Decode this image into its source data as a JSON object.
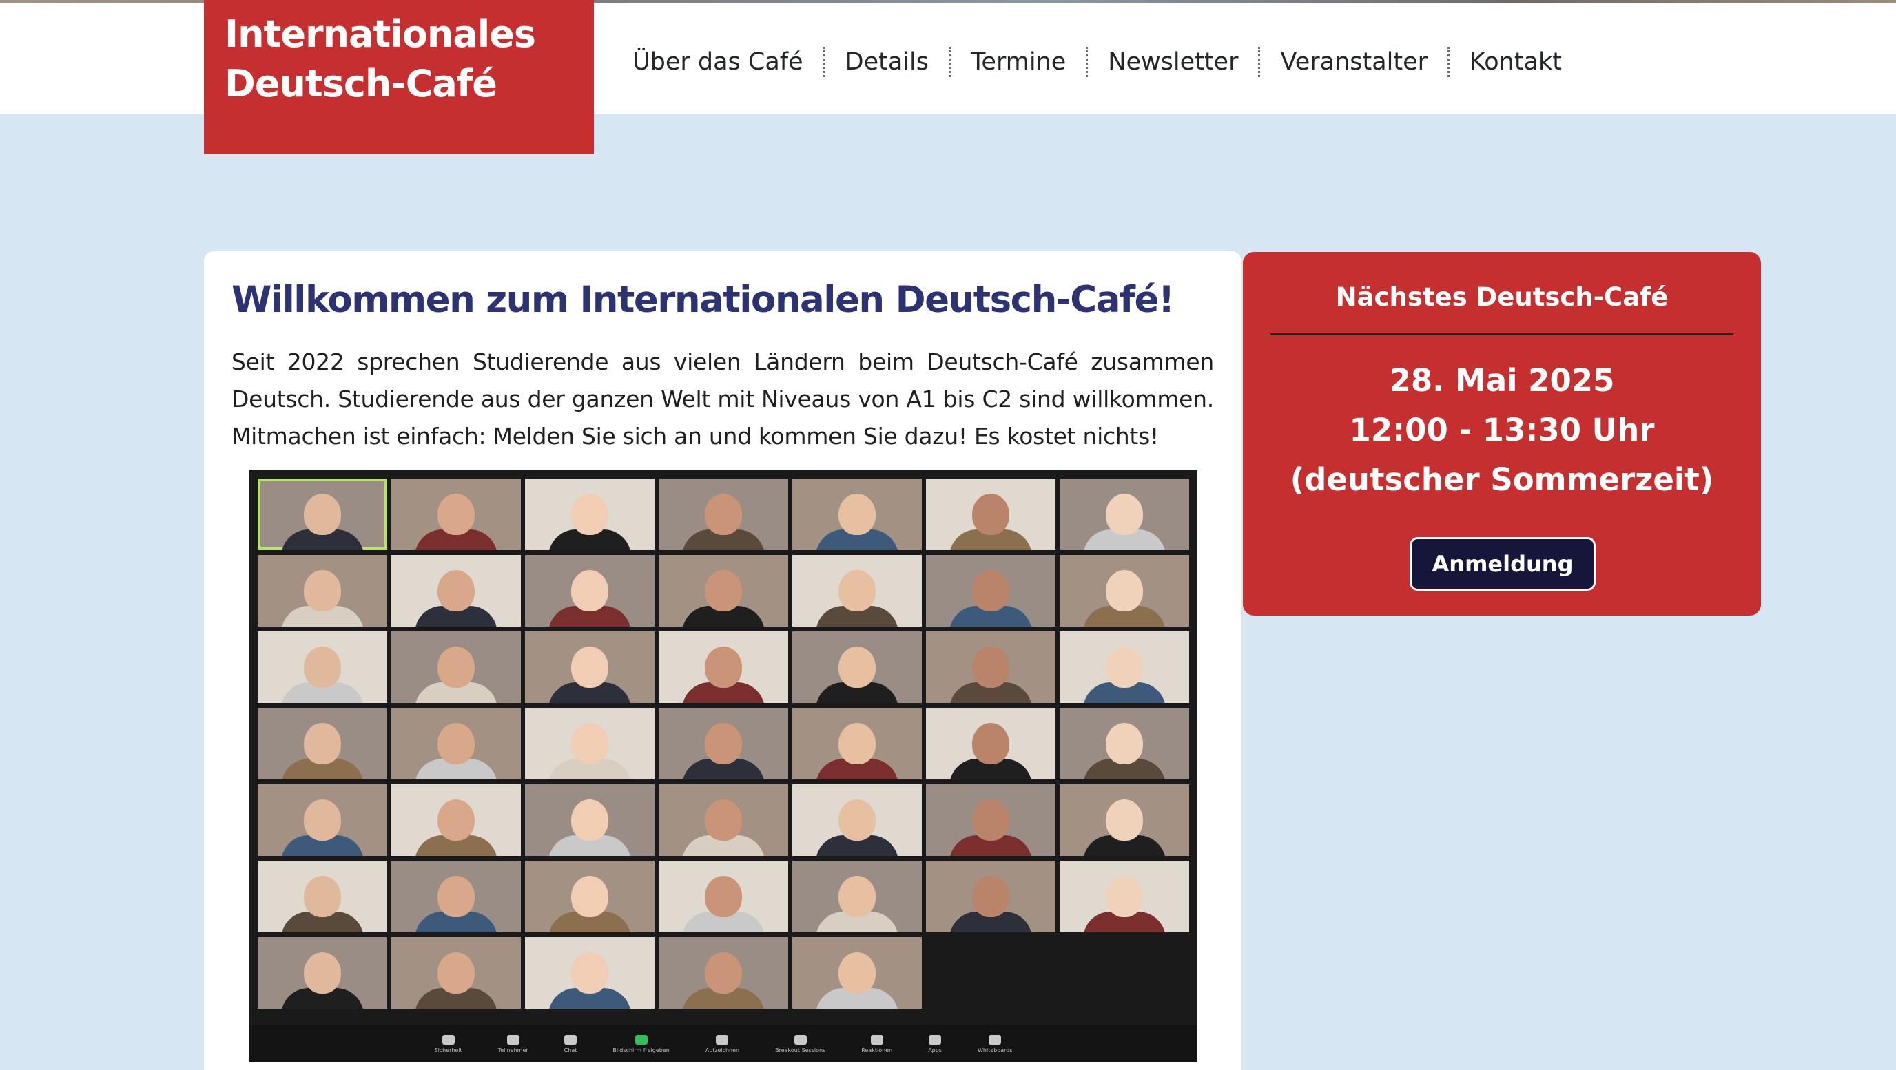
{
  "site": {
    "logo_line1": "Internationales",
    "logo_line2": "Deutsch-Café",
    "brand_color": "#c62f2f",
    "title_color": "#2c3272",
    "background_color": "#d6e6f2"
  },
  "nav": {
    "items": [
      {
        "label": "Über das Café"
      },
      {
        "label": "Details"
      },
      {
        "label": "Termine"
      },
      {
        "label": "Newsletter"
      },
      {
        "label": "Veranstalter"
      },
      {
        "label": "Kontakt"
      }
    ]
  },
  "main": {
    "title": "Willkommen zum Internationalen Deutsch-Café!",
    "intro": "Seit 2022 sprechen Studierende aus vielen Ländern beim Deutsch-Café zusammen Deutsch. Studierende aus der ganzen Welt mit Niveaus von A1 bis C2 sind willkommen. Mitmachen ist einfach: Melden Sie sich an und kommen Sie dazu! Es kostet nichts!",
    "image": {
      "description": "Zoom gallery screenshot",
      "toolbar": [
        "Sicherheit",
        "Teilnehmer",
        "Chat",
        "Bildschirm freigeben",
        "Aufzeichnen",
        "Breakout Sessions",
        "Reaktionen",
        "Apps",
        "Whiteboards"
      ]
    }
  },
  "next_event": {
    "title": "Nächstes Deutsch-Café",
    "date": "28. Mai 2025",
    "time": "12:00 - 13:30 Uhr",
    "timezone": "(deutscher Sommerzeit)",
    "button_label": "Anmeldung"
  }
}
